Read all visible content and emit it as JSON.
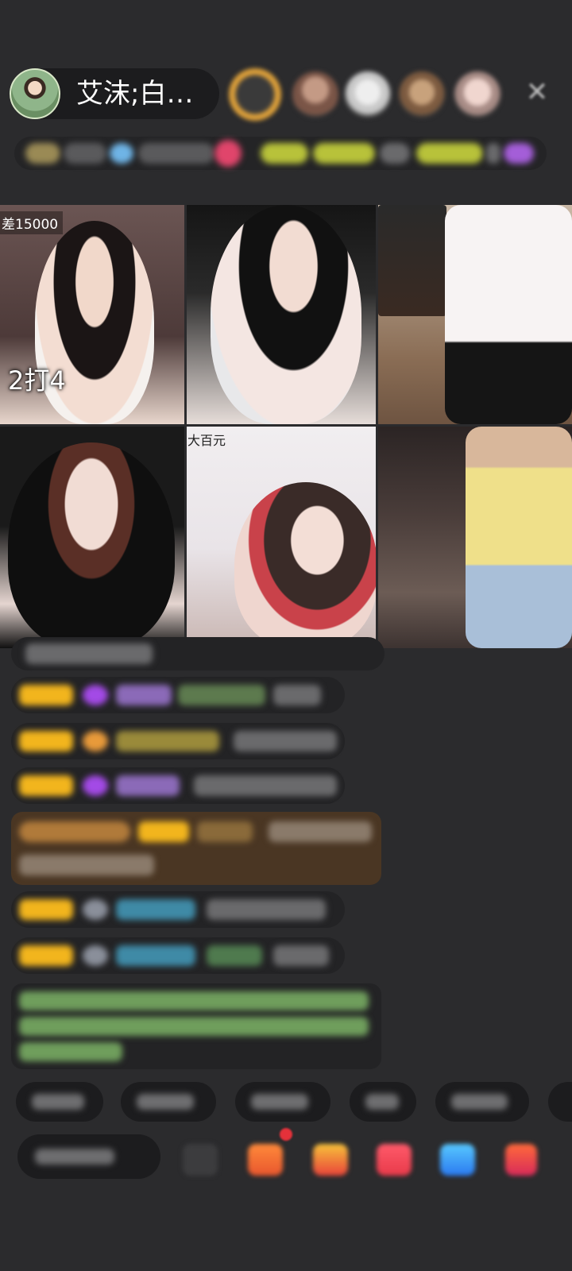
{
  "host": {
    "name": "艾沫;白…"
  },
  "icons": {
    "close": "close-icon"
  },
  "grid": {
    "cell1_top_label": "差15000",
    "cell1_score_label": "2打4",
    "cell5_caption": "大百元"
  },
  "colors": {
    "background": "#2b2b2d",
    "pill": "#1c1c1e",
    "badge_yellow": "#f2b51d",
    "name_purple": "#9b5cf0",
    "name_cyan": "#56c8e8",
    "system_green": "#7fc96b",
    "highlight_brown": "#5b3f1f",
    "notification_red": "#e5313a"
  }
}
